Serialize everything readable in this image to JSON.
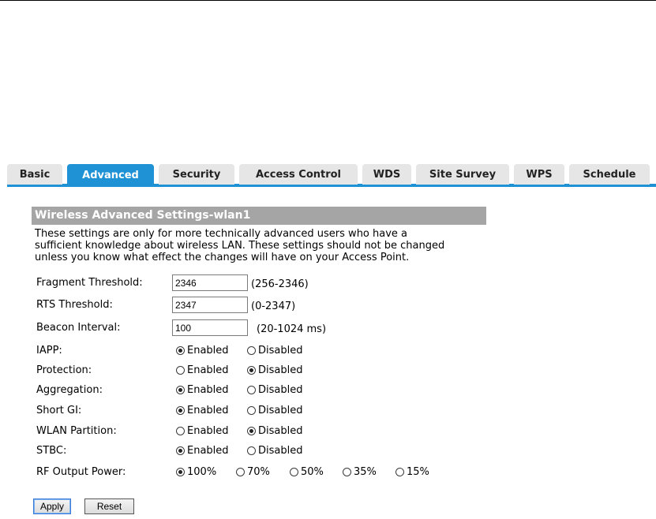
{
  "tabs": [
    "Basic",
    "Advanced",
    "Security",
    "Access Control",
    "WDS",
    "Site Survey",
    "WPS",
    "Schedule"
  ],
  "active_tab": "Advanced",
  "section_title": "Wireless Advanced Settings-wlan1",
  "description_lines": [
    "These settings are only for more technically advanced users who have a",
    "sufficient knowledge about wireless LAN. These settings should not be changed",
    "unless you know what effect the changes will have on your Access Point."
  ],
  "fields": {
    "fragment": {
      "label": "Fragment Threshold:",
      "value": "2346",
      "hint": "(256-2346)"
    },
    "rts": {
      "label": "RTS Threshold:",
      "value": "2347",
      "hint": "(0-2347)"
    },
    "beacon": {
      "label": "Beacon Interval:",
      "value": "100",
      "hint": "(20-1024 ms)"
    }
  },
  "radios": {
    "iapp": {
      "label": "IAPP:",
      "enabled": "Enabled",
      "disabled": "Disabled",
      "selected": "Enabled"
    },
    "protection": {
      "label": "Protection:",
      "enabled": "Enabled",
      "disabled": "Disabled",
      "selected": "Disabled"
    },
    "aggregation": {
      "label": "Aggregation:",
      "enabled": "Enabled",
      "disabled": "Disabled",
      "selected": "Enabled"
    },
    "short_gi": {
      "label": "Short GI:",
      "enabled": "Enabled",
      "disabled": "Disabled",
      "selected": "Enabled"
    },
    "wlan_partition": {
      "label": "WLAN Partition:",
      "enabled": "Enabled",
      "disabled": "Disabled",
      "selected": "Disabled"
    },
    "stbc": {
      "label": "STBC:",
      "enabled": "Enabled",
      "disabled": "Disabled",
      "selected": "Enabled"
    }
  },
  "rf_power": {
    "label": "RF Output Power:",
    "options": [
      "100%",
      "70%",
      "50%",
      "35%",
      "15%"
    ],
    "selected": "100%"
  },
  "buttons": {
    "apply": "Apply",
    "reset": "Reset"
  },
  "colors": {
    "tab_active": "#1f92d6",
    "tab_inactive": "#e6e6e6",
    "section_header": "#a5a5a5"
  }
}
